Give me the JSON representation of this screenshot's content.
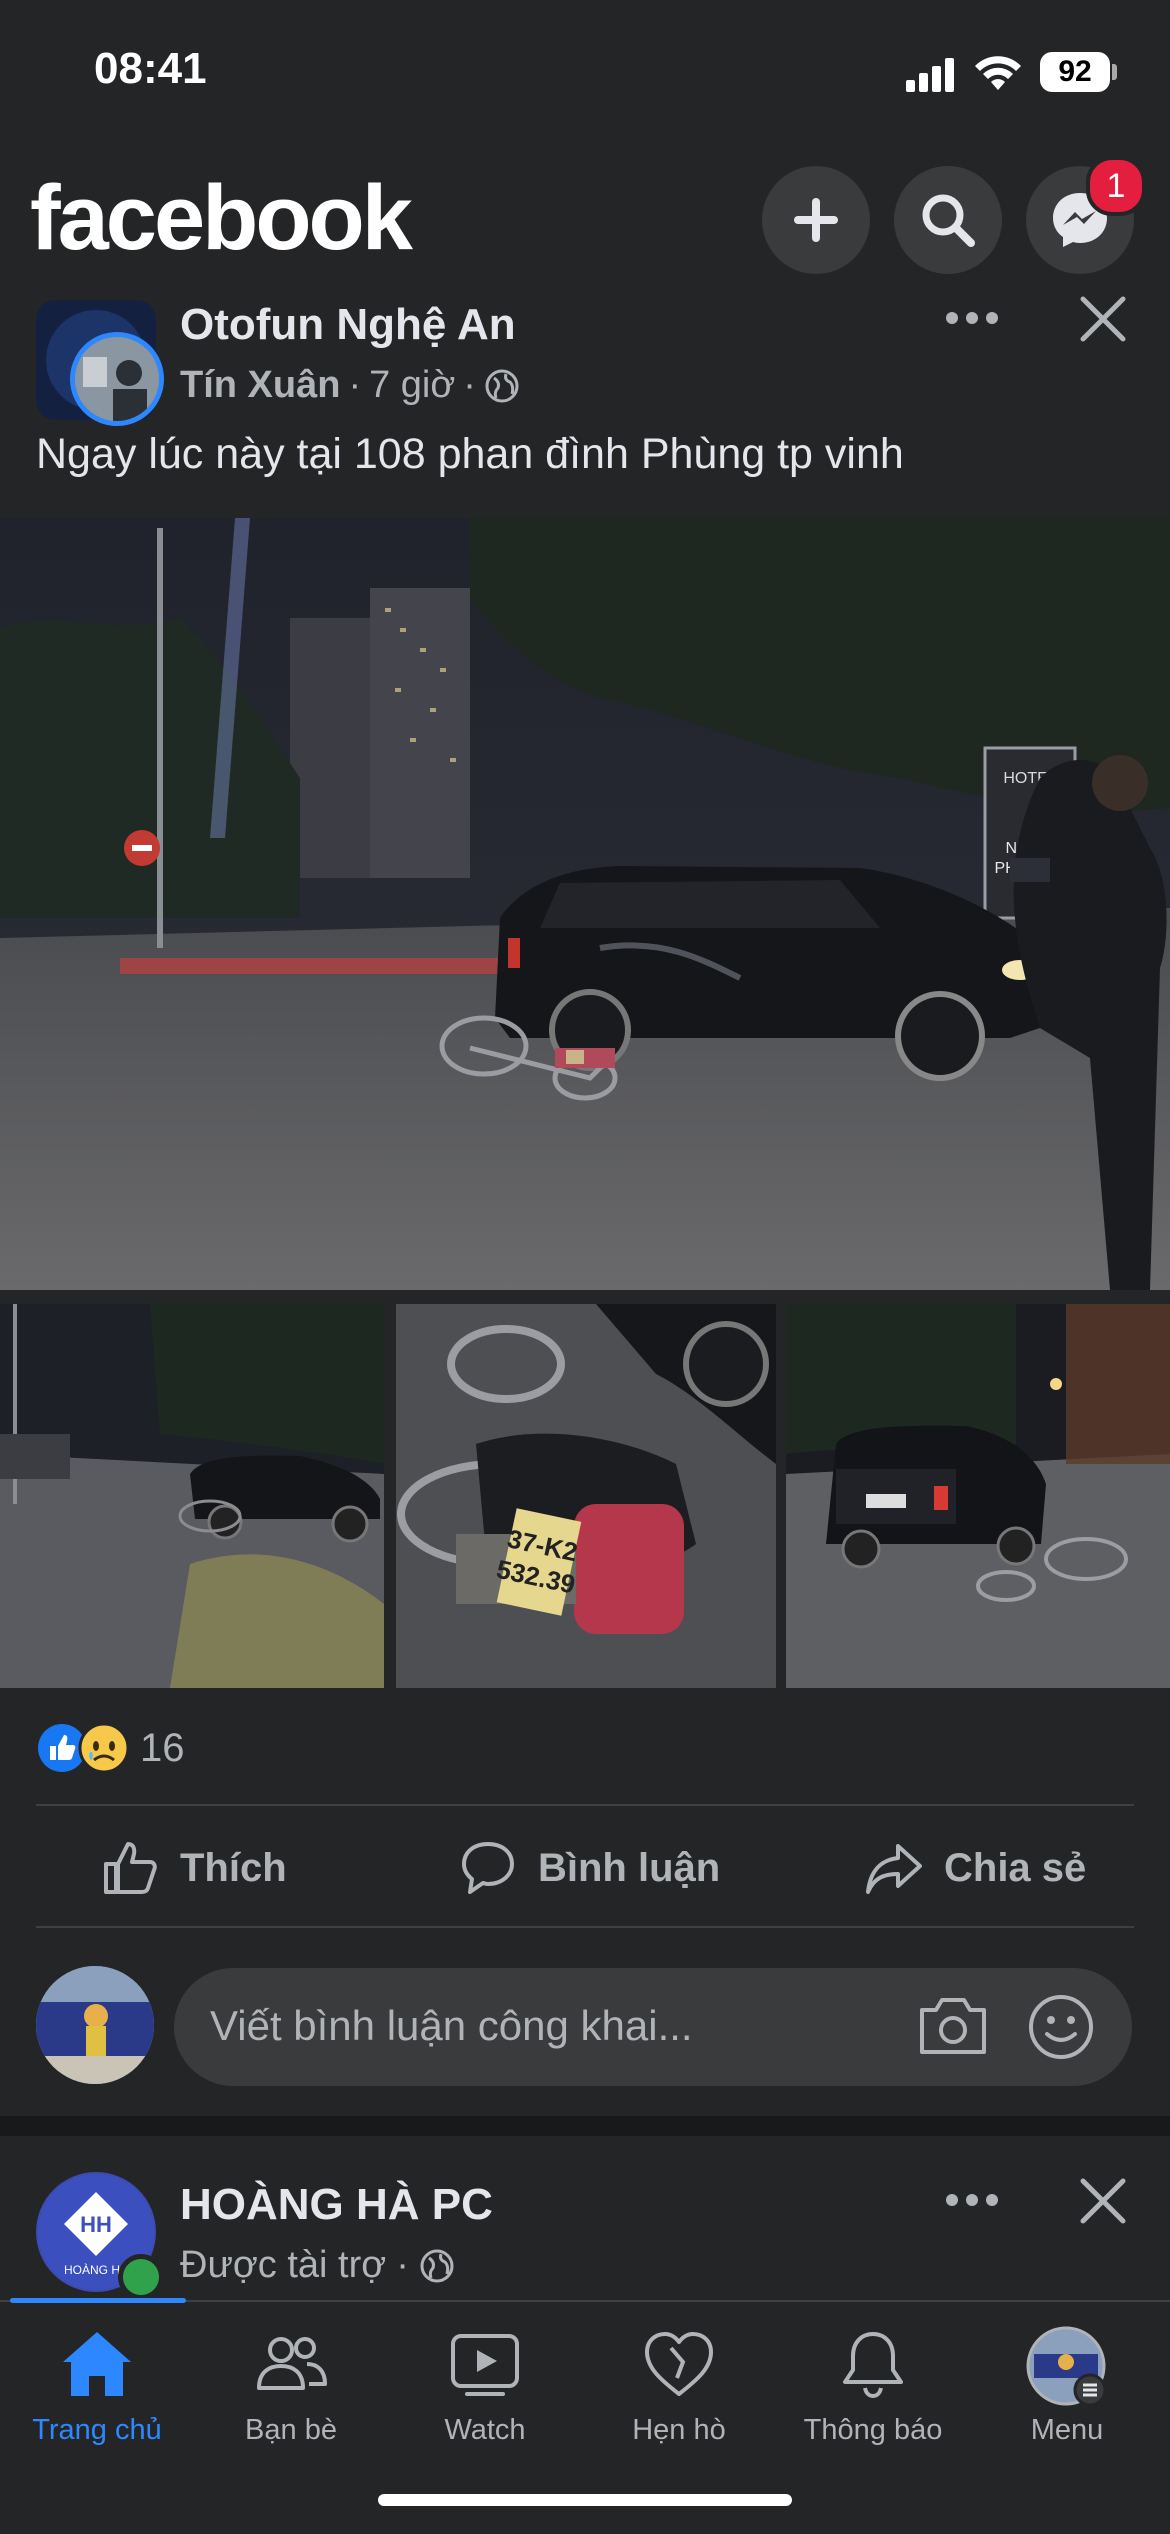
{
  "status_bar": {
    "time": "08:41",
    "battery": "92"
  },
  "header": {
    "logo": "facebook",
    "messenger_badge": "1"
  },
  "post": {
    "page_name": "Otofun Nghệ An",
    "author": "Tín Xuân",
    "time": "7 giờ",
    "text": "Ngay lúc này tại 108 phan đình Phùng tp vinh",
    "image_text": {
      "hotel_sign": "HOTEL",
      "shop_sign": "NHÔM\nPHÚ LÂM",
      "plate": "37-K2\n532.39"
    },
    "reaction_count": "16",
    "actions": {
      "like": "Thích",
      "comment": "Bình luận",
      "share": "Chia sẻ"
    },
    "comment_placeholder": "Viết bình luận công khai..."
  },
  "sponsored_post": {
    "page_name": "HOÀNG HÀ PC",
    "label": "Được tài trợ",
    "logo_text": "HOÀNG HÀ"
  },
  "bottom_nav": [
    {
      "label": "Trang chủ",
      "icon": "home-icon",
      "active": true
    },
    {
      "label": "Bạn bè",
      "icon": "friends-icon"
    },
    {
      "label": "Watch",
      "icon": "watch-icon"
    },
    {
      "label": "Hẹn hò",
      "icon": "dating-icon"
    },
    {
      "label": "Thông báo",
      "icon": "bell-icon"
    },
    {
      "label": "Menu",
      "icon": "menu-avatar-icon"
    }
  ],
  "colors": {
    "background": "#242526",
    "accent": "#2d88ff",
    "badge": "#e41e3f",
    "muted": "#b0b3b8"
  }
}
